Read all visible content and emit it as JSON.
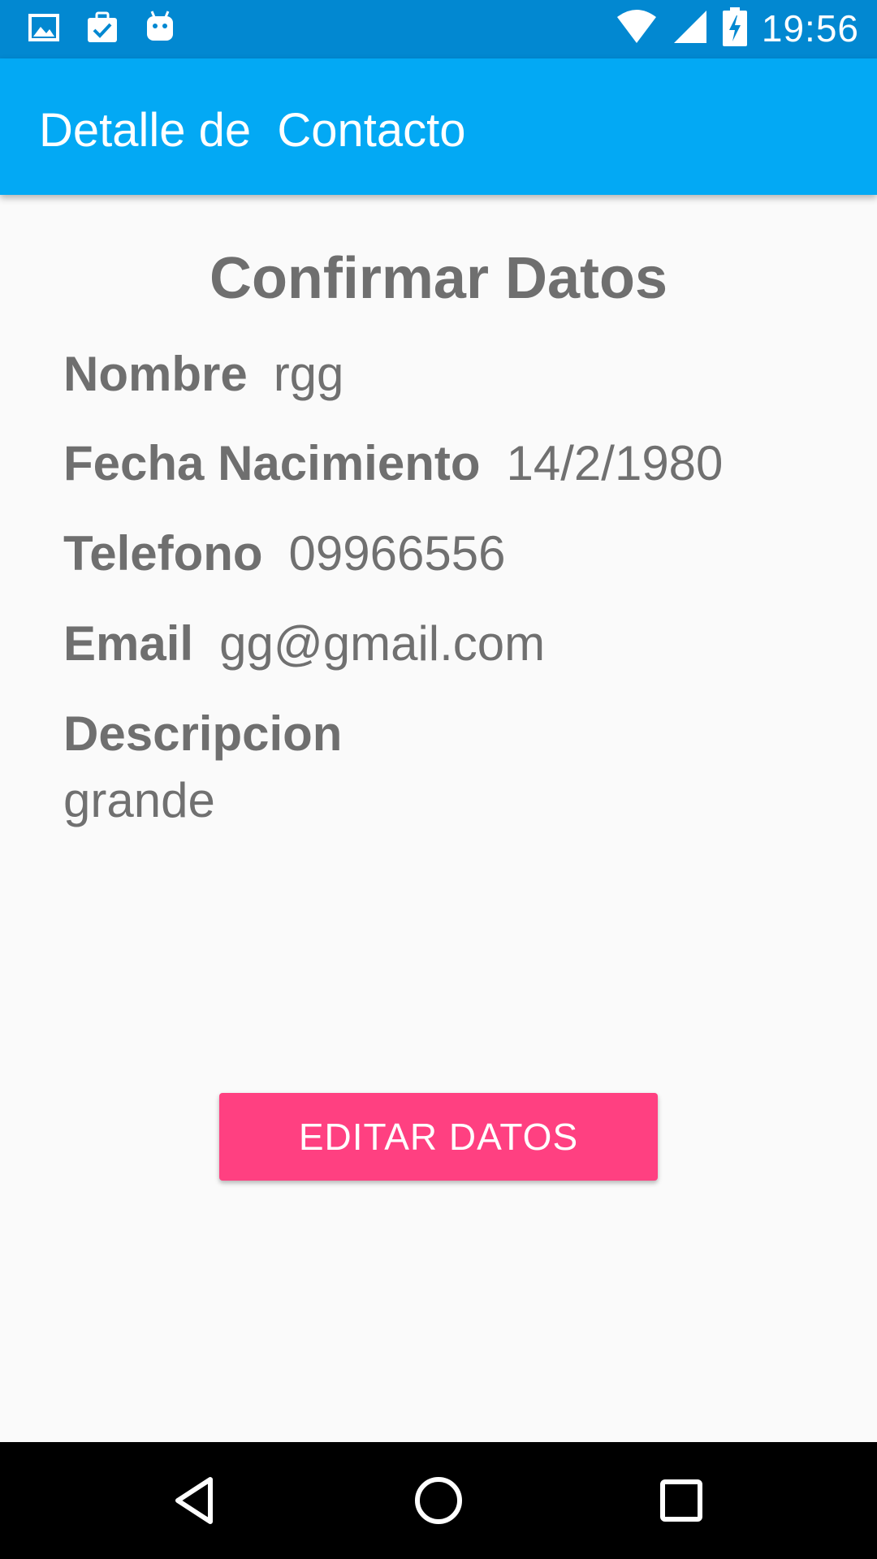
{
  "status_bar": {
    "time": "19:56",
    "left_icons": [
      "image-icon",
      "clipboard-check-icon",
      "android-icon"
    ],
    "right_icons": [
      "wifi-icon",
      "signal-icon",
      "battery-charging-icon"
    ]
  },
  "app_bar": {
    "title": "Detalle de  Contacto",
    "color": "#03a9f4"
  },
  "main": {
    "heading": "Confirmar Datos",
    "fields": {
      "nombre": {
        "label": "Nombre",
        "value": "rgg"
      },
      "fecha": {
        "label": "Fecha Nacimiento",
        "value": "14/2/1980"
      },
      "telefono": {
        "label": "Telefono",
        "value": "09966556"
      },
      "email": {
        "label": "Email",
        "value": "gg@gmail.com"
      },
      "descripcion": {
        "label": "Descripcion",
        "value": "grande"
      }
    },
    "edit_button": {
      "label": "EDITAR DATOS",
      "color": "#ff4081"
    }
  },
  "nav_bar": {
    "icons": [
      "back-icon",
      "home-icon",
      "recents-icon"
    ]
  }
}
